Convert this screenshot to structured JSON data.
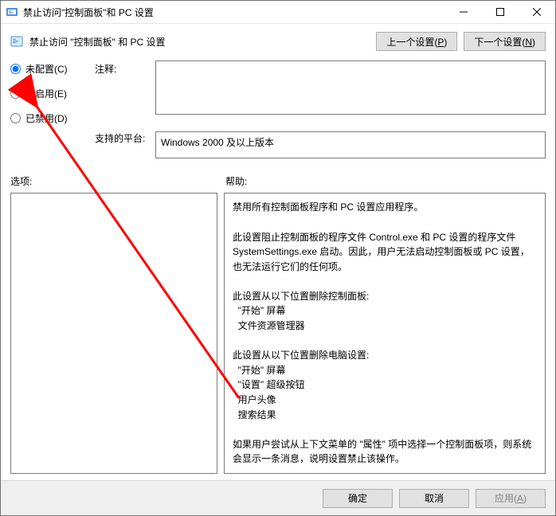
{
  "window": {
    "title": "禁止访问\"控制面板\"和 PC 设置"
  },
  "header": {
    "policy_name": "禁止访问 \"控制面板\" 和 PC 设置",
    "prev_btn": "上一个设置(",
    "prev_key": "P",
    "prev_btn_end": ")",
    "next_btn": "下一个设置(",
    "next_key": "N",
    "next_btn_end": ")"
  },
  "radios": {
    "not_configured": "未配置(",
    "not_configured_key": "C",
    "not_configured_end": ")",
    "enabled": "已启用(",
    "enabled_key": "E",
    "enabled_end": ")",
    "disabled": "已禁用(",
    "disabled_key": "D",
    "disabled_end": ")",
    "selected": "not_configured"
  },
  "labels": {
    "comment": "注释:",
    "supported": "支持的平台:",
    "options": "选项:",
    "help": "帮助:"
  },
  "fields": {
    "comment_value": "",
    "supported_value": "Windows 2000 及以上版本"
  },
  "help_text": "禁用所有控制面板程序和 PC 设置应用程序。\n\n此设置阻止控制面板的程序文件 Control.exe 和 PC 设置的程序文件 SystemSettings.exe 启动。因此，用户无法启动控制面板或 PC 设置，也无法运行它们的任何项。\n\n此设置从以下位置删除控制面板:\n  \"开始\" 屏幕\n  文件资源管理器\n\n此设置从以下位置删除电脑设置:\n  \"开始\" 屏幕\n  \"设置\" 超级按钮\n  用户头像\n  搜索结果\n\n如果用户尝试从上下文菜单的 \"属性\" 项中选择一个控制面板项，则系统会显示一条消息，说明设置禁止该操作。",
  "footer": {
    "ok": "确定",
    "cancel": "取消",
    "apply": "应用(",
    "apply_key": "A",
    "apply_end": ")"
  }
}
